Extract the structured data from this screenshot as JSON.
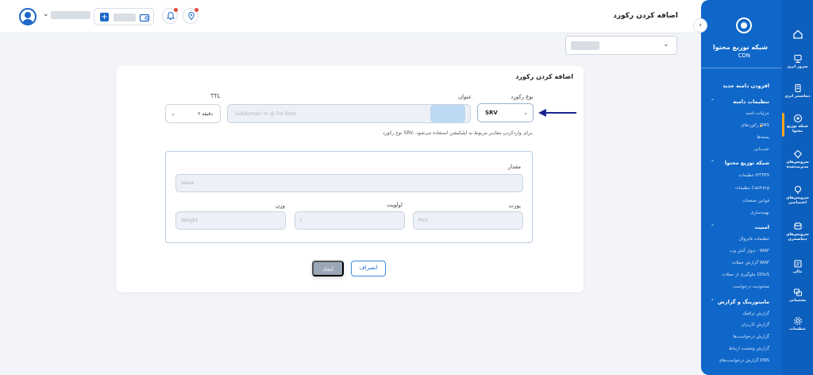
{
  "header": {
    "page_title": "اضافه کردن رکورد",
    "wallet_plus": "+"
  },
  "domain_select": {
    "chevron": "⌄"
  },
  "card": {
    "title": "اضافه کردن رکورد",
    "record_type_label": "نوع رکورد",
    "record_type_value": "SRV",
    "name_label": "عنوان",
    "name_placeholder": "Subdomain or @ For Root",
    "ttl_label": "TTL",
    "ttl_value": "۲ دقیقه",
    "hint": "نوع رکورد SRV، برای واردکردن مقادیر مربوط به اپلیکیشن استفاده می‌شود.",
    "value_label": "مقدار",
    "value_placeholder": "Value",
    "port_label": "پورت",
    "port_placeholder": "Port",
    "priority_label": "اولویت",
    "priority_placeholder": "I",
    "weight_label": "وزن",
    "weight_placeholder": "Weight",
    "cancel_label": "انصراف",
    "create_label": "ایجاد"
  },
  "sidebar": {
    "brand_title": "شبکه توزیع محتوا",
    "brand_sub": "CDN",
    "items": [
      {
        "label": "افزودن دامنه جدید",
        "kind": "head"
      },
      {
        "label": "تنظیمات دامنه",
        "kind": "head"
      },
      {
        "label": "جزئیات دامنه",
        "kind": "sub"
      },
      {
        "label": "رکوردهای DNS",
        "kind": "sub"
      },
      {
        "label": "پسته‌ها",
        "kind": "sub"
      },
      {
        "label": "عیب‌یابی",
        "kind": "sub"
      },
      {
        "label": "شبکه توزیع محتوا",
        "kind": "head"
      },
      {
        "label": "تنظیمات HTTPS",
        "kind": "sub"
      },
      {
        "label": "تنظیمات Caching",
        "kind": "sub"
      },
      {
        "label": "قوانین صفحات",
        "kind": "sub"
      },
      {
        "label": "بهینه‌سازی",
        "kind": "sub"
      },
      {
        "label": "امنیت",
        "kind": "head"
      },
      {
        "label": "تنظیمات فایروال",
        "kind": "sub"
      },
      {
        "label": "دیوار آتش وب - WAF",
        "kind": "sub"
      },
      {
        "label": "گزارش حملات WAF",
        "kind": "sub"
      },
      {
        "label": "جلوگیری از حملات DDoS",
        "kind": "sub"
      },
      {
        "label": "محدودیت درخواست",
        "kind": "sub"
      },
      {
        "label": "مانیتورینگ و گزارش",
        "kind": "head"
      },
      {
        "label": "گزارش ترافیک",
        "kind": "sub"
      },
      {
        "label": "گزارش کاربران",
        "kind": "sub"
      },
      {
        "label": "گزارش درخواست‌ها",
        "kind": "sub"
      },
      {
        "label": "گزارش وضعیت ارتباط",
        "kind": "sub"
      },
      {
        "label": "گزارش درخواست‌های DNS",
        "kind": "sub"
      }
    ]
  },
  "rail": [
    {
      "label": "",
      "icon": "home-icon"
    },
    {
      "label": "سرور ابری",
      "icon": "server-icon"
    },
    {
      "label": "دیتاسنتر ابری",
      "icon": "datacenter-icon"
    },
    {
      "label": "شبکه توزیع محتوا",
      "icon": "cdn-icon"
    },
    {
      "label": "سرویس‌های مدیریت‌شده",
      "icon": "managed-icon"
    },
    {
      "label": "سرویس‌های اختصاصی",
      "icon": "dedicated-icon"
    },
    {
      "label": "سرویس‌های دیتاسنتری",
      "icon": "dc-services-icon"
    },
    {
      "label": "مالی",
      "icon": "finance-icon"
    },
    {
      "label": "پشتیبانی",
      "icon": "support-icon"
    },
    {
      "label": "تنظیمات",
      "icon": "settings-icon"
    }
  ]
}
